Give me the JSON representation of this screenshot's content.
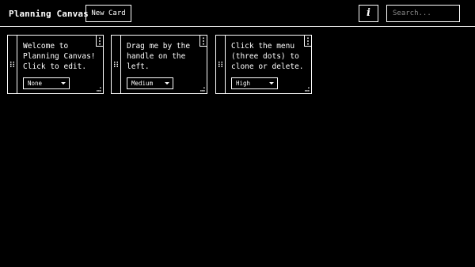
{
  "header": {
    "title": "Planning Canvas",
    "new_card_label": "New Card",
    "info_label": "i",
    "search_placeholder": "Search..."
  },
  "cards": [
    {
      "lines": [
        "Welcome to",
        "Planning Canvas!",
        "Click to edit."
      ],
      "priority": "None"
    },
    {
      "lines": [
        "Drag me by the",
        "handle on the",
        "left."
      ],
      "priority": "Medium"
    },
    {
      "lines": [
        "Click the menu",
        "(three dots) to",
        "clone or delete."
      ],
      "priority": "High"
    }
  ],
  "icons": {
    "drag_handle": "grip-dots-icon",
    "card_menu": "three-dots-vertical-icon",
    "resize": "resize-corner-icon",
    "select": "caret-down-icon",
    "info": "info-icon"
  }
}
